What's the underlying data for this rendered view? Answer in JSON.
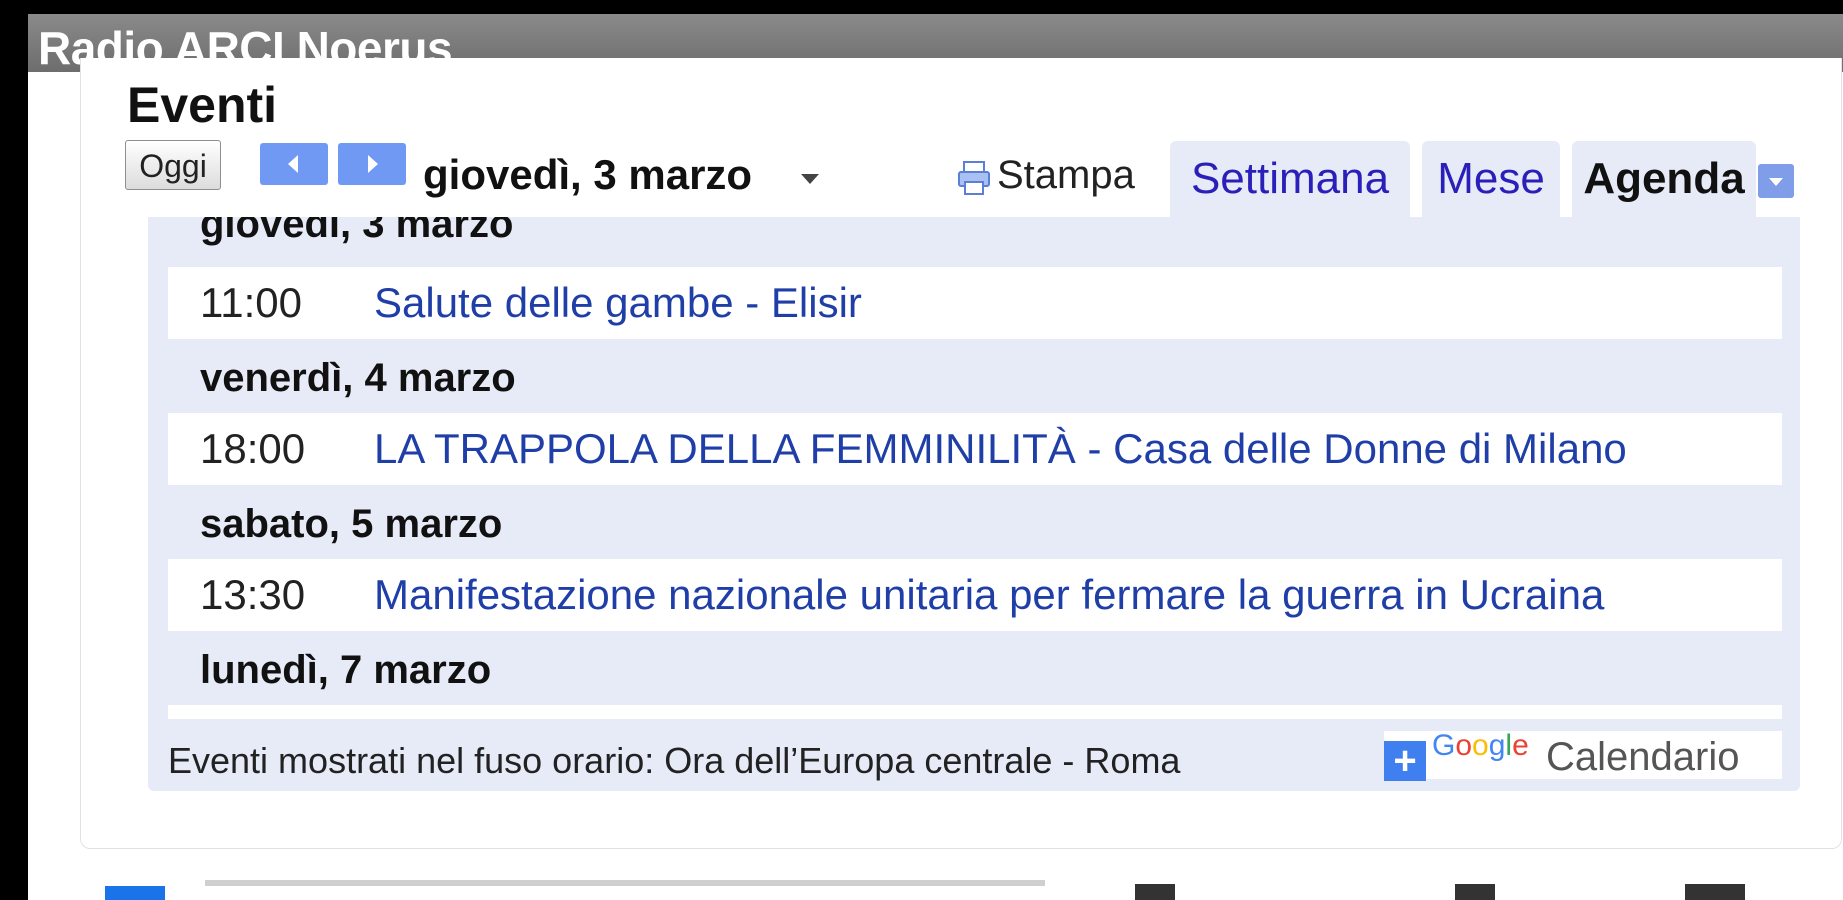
{
  "window": {
    "title": "Radio ARCI Noerus"
  },
  "widget": {
    "heading": "Eventi",
    "toolbar": {
      "today_label": "Oggi",
      "current_date": "giovedì, 3 marzo",
      "print_label": "Stampa",
      "tabs": [
        {
          "label": "Settimana",
          "active": false
        },
        {
          "label": "Mese",
          "active": false
        },
        {
          "label": "Agenda",
          "active": true
        }
      ]
    },
    "agenda": {
      "days": [
        {
          "label": "giovedì, 3 marzo",
          "events": [
            {
              "time": "11:00",
              "title": "Salute delle gambe - Elisir"
            }
          ]
        },
        {
          "label": "venerdì, 4 marzo",
          "events": [
            {
              "time": "18:00",
              "title": "LA TRAPPOLA DELLA FEMMINILITÀ - Casa delle Donne di Milano"
            }
          ]
        },
        {
          "label": "sabato, 5 marzo",
          "events": [
            {
              "time": "13:30",
              "title": "Manifestazione nazionale unitaria per fermare la guerra in Ucraina"
            }
          ]
        },
        {
          "label": "lunedì, 7 marzo",
          "events": []
        }
      ]
    },
    "footer": {
      "timezone_note": "Eventi mostrati nel fuso orario: Ora dell’Europa centrale - Roma",
      "google_logo": "Google",
      "calendar_label": "Calendario"
    }
  },
  "colors": {
    "link": "#1f3ea8",
    "tab_link": "#2a1fb8",
    "panel_bg": "#e6ebf7",
    "nav_button": "#6f99f2"
  }
}
